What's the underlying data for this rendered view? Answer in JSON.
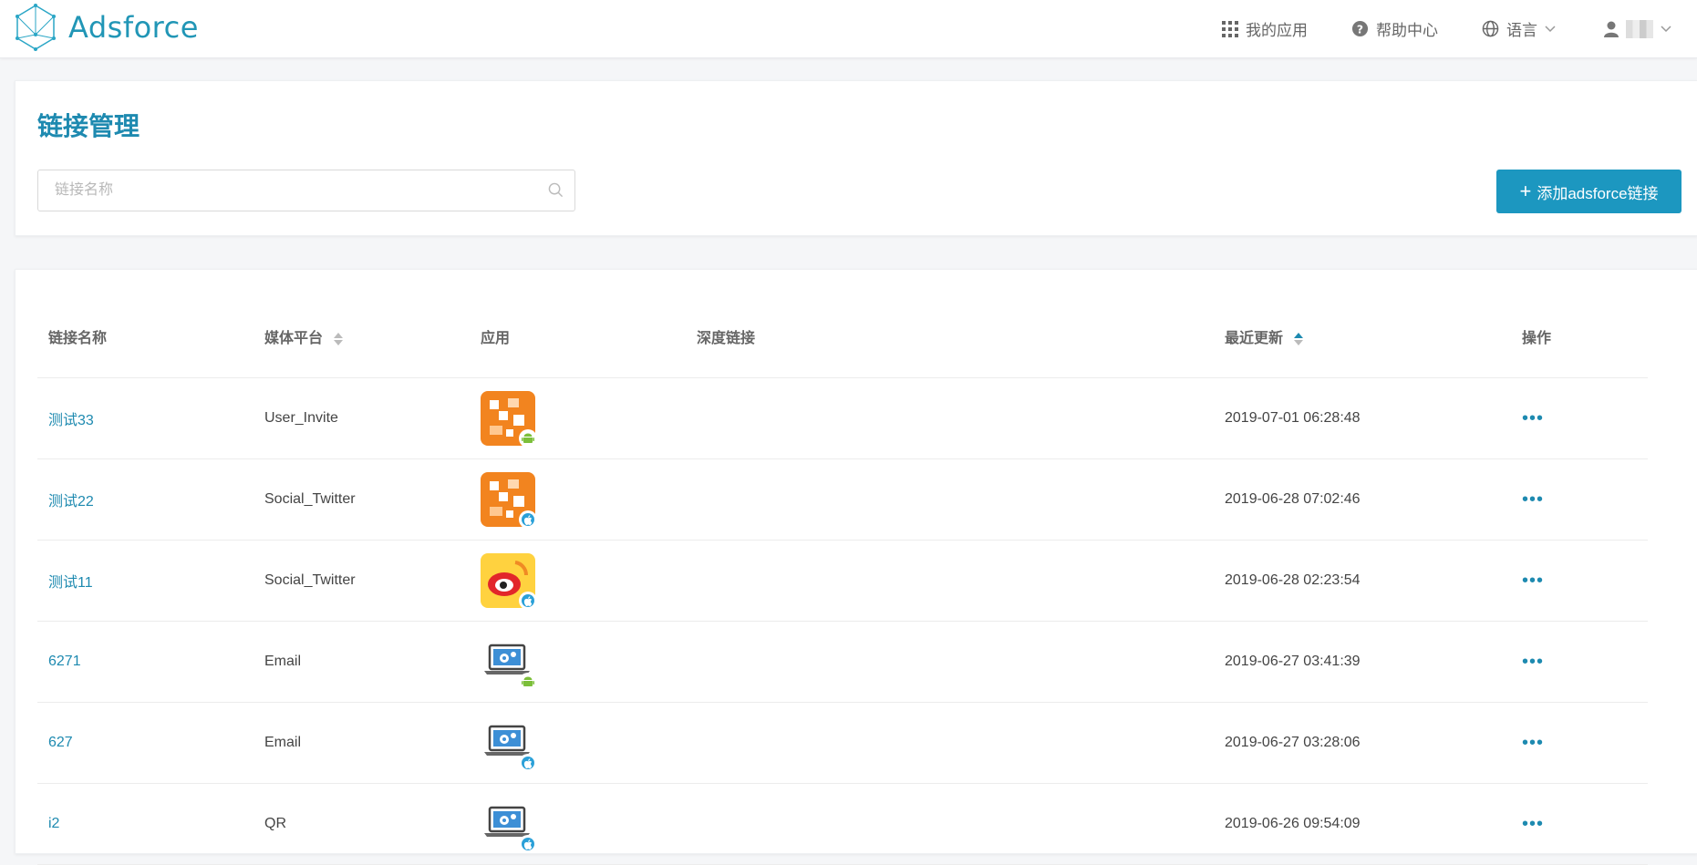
{
  "brand": {
    "name": "Adsforce",
    "accent": "#1c97c0"
  },
  "nav": {
    "apps": "我的应用",
    "help": "帮助中心",
    "language": "语言"
  },
  "header": {
    "title": "链接管理",
    "search_placeholder": "链接名称",
    "add_button": "添加adsforce链接"
  },
  "table": {
    "columns": {
      "name": "链接名称",
      "platform": "媒体平台",
      "app": "应用",
      "deeplink": "深度链接",
      "updated": "最近更新",
      "action": "操作"
    },
    "rows": [
      {
        "name": "测试33",
        "platform": "User_Invite",
        "app_os": "android",
        "app_icon": "orange-pixel-icon",
        "deeplink": "",
        "updated": "2019-07-01 06:28:48",
        "action": "•••"
      },
      {
        "name": "测试22",
        "platform": "Social_Twitter",
        "app_os": "ios",
        "app_icon": "orange-pixel-icon",
        "deeplink": "",
        "updated": "2019-06-28 07:02:46",
        "action": "•••"
      },
      {
        "name": "测试11",
        "platform": "Social_Twitter",
        "app_os": "ios",
        "app_icon": "weibo-like-icon",
        "deeplink": "",
        "updated": "2019-06-28 02:23:54",
        "action": "•••"
      },
      {
        "name": "6271",
        "platform": "Email",
        "app_os": "android",
        "app_icon": "laptop-gear-icon",
        "deeplink": "",
        "updated": "2019-06-27 03:41:39",
        "action": "•••"
      },
      {
        "name": "627",
        "platform": "Email",
        "app_os": "ios",
        "app_icon": "laptop-gear-icon",
        "deeplink": "",
        "updated": "2019-06-27 03:28:06",
        "action": "•••"
      },
      {
        "name": "i2",
        "platform": "QR",
        "app_os": "ios",
        "app_icon": "laptop-gear-icon",
        "deeplink": "",
        "updated": "2019-06-26 09:54:09",
        "action": "•••"
      }
    ]
  }
}
